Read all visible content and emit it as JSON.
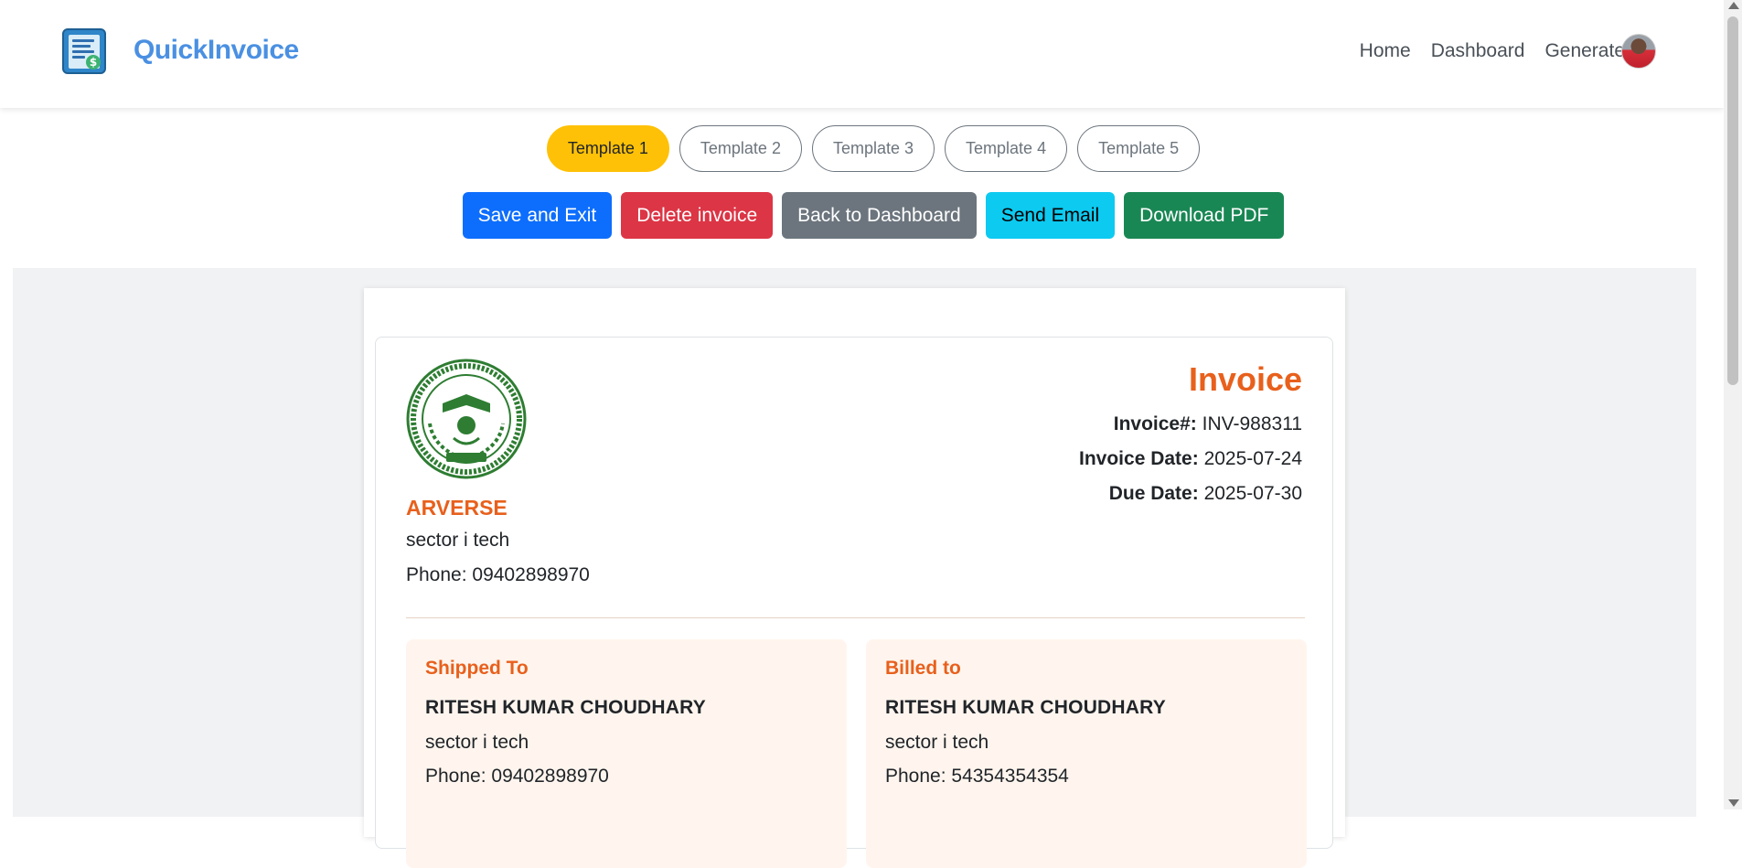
{
  "navbar": {
    "brand": "QuickInvoice",
    "links": [
      "Home",
      "Dashboard",
      "Generate"
    ],
    "icons": {
      "logo": "invoice-logo-icon",
      "avatar": "user-avatar"
    }
  },
  "templates": [
    "Template 1",
    "Template 2",
    "Template 3",
    "Template 4",
    "Template 5"
  ],
  "active_template": "Template 1",
  "actions": {
    "save_exit": "Save and Exit",
    "delete": "Delete invoice",
    "back": "Back to Dashboard",
    "email": "Send Email",
    "download": "Download PDF"
  },
  "invoice": {
    "title": "Invoice",
    "number_label": "Invoice#:",
    "number": "INV-988311",
    "date_label": "Invoice Date:",
    "date": "2025-07-24",
    "due_label": "Due Date:",
    "due": "2025-07-30",
    "company": {
      "name": "ARVERSE",
      "address": "sector i tech",
      "phone": "Phone: 09402898970"
    },
    "shipped_to": {
      "heading": "Shipped To",
      "name": "RITESH KUMAR CHOUDHARY",
      "address": "sector i tech",
      "phone": "Phone: 09402898970"
    },
    "billed_to": {
      "heading": "Billed to",
      "name": "RITESH KUMAR CHOUDHARY",
      "address": "sector i tech",
      "phone": "Phone: 54354354354"
    }
  },
  "colors": {
    "accent": "#e8601c",
    "brand": "#4a90e2",
    "active_template": "#ffc107"
  }
}
